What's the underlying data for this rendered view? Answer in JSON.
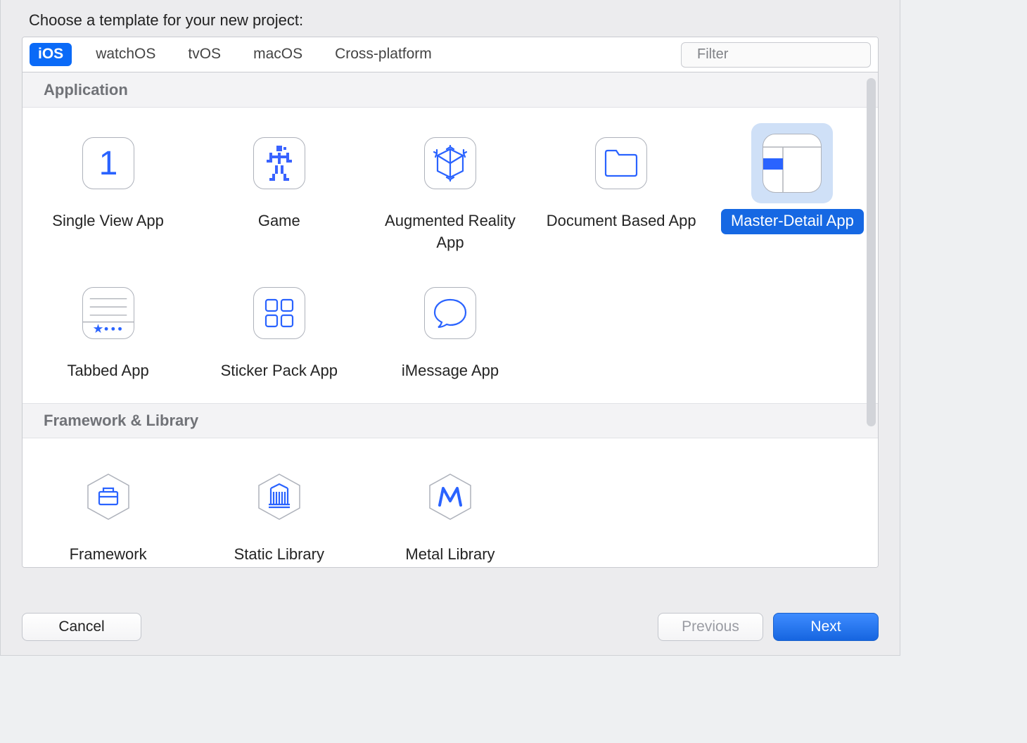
{
  "title": "Choose a template for your new project:",
  "tabs": {
    "ios": "iOS",
    "watchos": "watchOS",
    "tvos": "tvOS",
    "macos": "macOS",
    "cross": "Cross-platform"
  },
  "filter": {
    "placeholder": "Filter"
  },
  "sections": {
    "application": "Application",
    "framework": "Framework & Library"
  },
  "templates": {
    "single_view": "Single View App",
    "game": "Game",
    "ar": "Augmented Reality App",
    "doc": "Document Based App",
    "master": "Master-Detail App",
    "tabbed": "Tabbed App",
    "sticker": "Sticker Pack App",
    "imessage": "iMessage App",
    "framework": "Framework",
    "static": "Static Library",
    "metal": "Metal Library"
  },
  "buttons": {
    "cancel": "Cancel",
    "previous": "Previous",
    "next": "Next"
  }
}
